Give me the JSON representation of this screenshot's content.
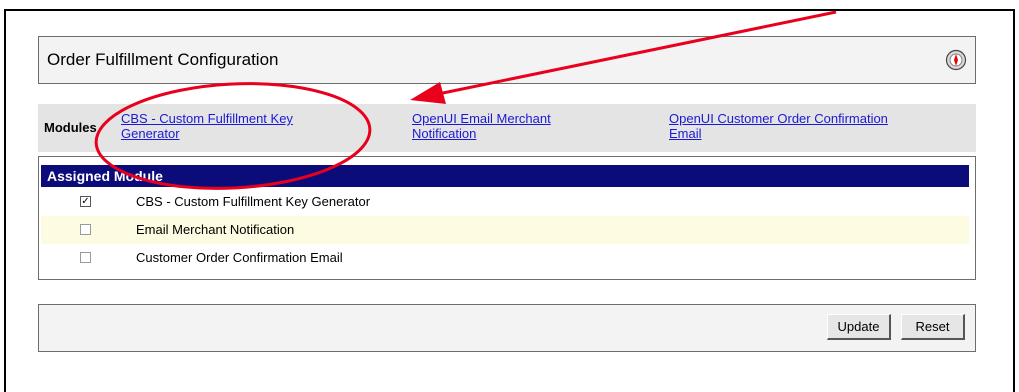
{
  "title": "Order Fulfillment Configuration",
  "modules": {
    "label": "Modules",
    "links": [
      {
        "line1": "CBS - Custom Fulfillment Key",
        "line2": "Generator"
      },
      {
        "line1": "OpenUI Email Merchant",
        "line2": "Notification"
      },
      {
        "line1": "OpenUI Customer Order Confirmation",
        "line2": "Email"
      }
    ]
  },
  "assigned": {
    "header": "Assigned Module",
    "rows": [
      {
        "label": "CBS - Custom Fulfillment Key Generator",
        "checked": true,
        "check_mark": "✓"
      },
      {
        "label": "Email Merchant Notification",
        "checked": false,
        "check_mark": ""
      },
      {
        "label": "Customer Order Confirmation Email",
        "checked": false,
        "check_mark": ""
      }
    ]
  },
  "buttons": {
    "update": "Update",
    "reset": "Reset"
  },
  "icons": {
    "help": "help-icon"
  },
  "colors": {
    "header_bg": "#0b0b7a",
    "link": "#1a1ad6",
    "annotation": "#e8001c",
    "alt_row": "#fdfbe1"
  }
}
